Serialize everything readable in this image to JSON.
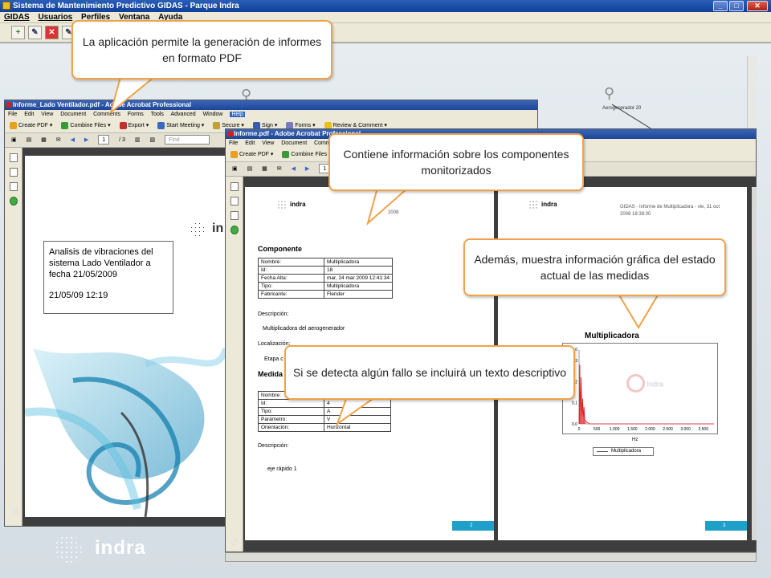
{
  "app": {
    "title": "Sistema de Mantenimiento Predictivo GIDAS - Parque Indra",
    "menu": [
      "GIDAS",
      "Usuarios",
      "Perfiles",
      "Ventana",
      "Ayuda"
    ],
    "turbine_label": "Aerogenerador 20"
  },
  "acrobat1": {
    "title": "Informe_Lado Ventilador.pdf - Adobe Acrobat Professional",
    "menu": [
      "File",
      "Edit",
      "View",
      "Document",
      "Comments",
      "Forms",
      "Tools",
      "Advanced",
      "Window",
      "Help"
    ],
    "toolbar": [
      "Create PDF",
      "Combine Files",
      "Export",
      "Start Meeting",
      "Secure",
      "Sign",
      "Forms",
      "Review & Comment"
    ],
    "page_current": "1",
    "page_total": "/ 3",
    "find_placeholder": "Find"
  },
  "cover": {
    "line1": "Analisis de vibraciones del",
    "line2": "sistema Lado Ventilador a",
    "line3": "fecha 21/05/2009",
    "datetime": "21/05/09 12:19",
    "logo": "in"
  },
  "acrobat2": {
    "title": "Informe.pdf - Adobe Acrobat Professional",
    "menu": [
      "File",
      "Edit",
      "View",
      "Document",
      "Comments"
    ],
    "toolbar": [
      "Create PDF",
      "Combine Files"
    ],
    "page_current": "1"
  },
  "page2": {
    "logo": "indra",
    "header": "GIDAS - Informe de Multiplicadora - vie, 31 oct 2008 18:38:00",
    "header_partial": "2008",
    "section_title": "Componente",
    "component_rows": [
      [
        "Nombre:",
        "Multiplicadora"
      ],
      [
        "Id:",
        "18"
      ],
      [
        "Fecha Alta:",
        "mar, 24 mar 2009 12:41:34"
      ],
      [
        "Tipo:",
        "Multiplicadora"
      ],
      [
        "Fabricante:",
        "Flender"
      ]
    ],
    "desc_label": "Descripción:",
    "desc_value": "Multiplicadora del aerogenerador",
    "loc_label": "Localización:",
    "loc_value": "Etapa c",
    "measures_title": "Medida",
    "measure_rows": [
      [
        "Nombre:",
        ""
      ],
      [
        "Id:",
        "4"
      ],
      [
        "Tipo:",
        "A"
      ],
      [
        "Parámetro:",
        "V"
      ],
      [
        "Orientación:",
        "Horizontal"
      ]
    ],
    "desc2_label": "Descripción:",
    "desc2_value": "eje rápido 1",
    "page_number": "2"
  },
  "page3": {
    "logo": "indra",
    "header_line1": "GIDAS - Informe de Multiplicadora - vie, 31 oct",
    "header_line2": "2008 18:38:00",
    "page_number": "3",
    "watermark": "Indra"
  },
  "chart_data": {
    "type": "line",
    "title": "Multiplicadora",
    "xlabel": "Hz",
    "ylabel": "",
    "x_ticks": [
      "0",
      "500",
      "1.000",
      "1.500",
      "2.000",
      "2.500",
      "3.000",
      "3.500"
    ],
    "y_ticks": [
      "0,0",
      "0,1",
      "0,2",
      "0,3"
    ],
    "y_top_label": "1,0",
    "xlim": [
      0,
      3800
    ],
    "ylim": [
      0,
      0.35
    ],
    "legend_position": "bottom",
    "series": [
      {
        "name": "Multiplicadora",
        "color": "#e0202a",
        "x": [
          0,
          20,
          40,
          60,
          80,
          100,
          120,
          140,
          160,
          200,
          300,
          500,
          1000,
          2000,
          3800
        ],
        "y": [
          0.0,
          0.28,
          0.06,
          0.22,
          0.04,
          0.12,
          0.03,
          0.08,
          0.02,
          0.01,
          0.0,
          0.0,
          0.0,
          0.0,
          0.0
        ]
      }
    ]
  },
  "callouts": {
    "c1": "La aplicación permite la generación de informes en formato PDF",
    "c2": "Contiene información sobre los componentes monitorizados",
    "c3": "Además, muestra información gráfica del estado actual de las medidas",
    "c4": "Si se detecta algún fallo se incluirá un texto descriptivo"
  },
  "brand": {
    "bottom_logo": "indra",
    "callout_border": "#f0a24a",
    "page_tab_color": "#1ea0c8"
  }
}
